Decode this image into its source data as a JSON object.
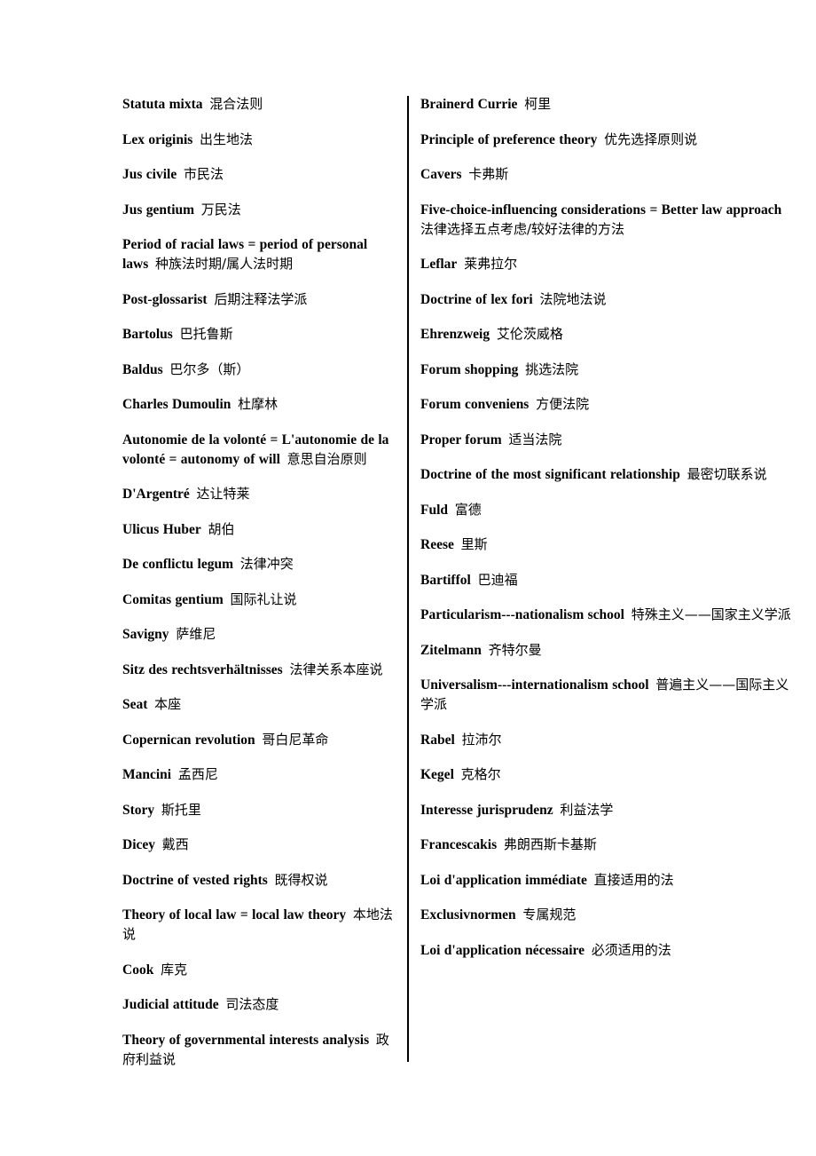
{
  "document": {
    "type": "bilingual-glossary",
    "subject": "Private International Law / Conflict of Laws terminology",
    "columns": [
      {
        "name": "left-column",
        "entries": [
          {
            "term": "Statuta mixta",
            "translation": "混合法则"
          },
          {
            "term": "Lex originis",
            "translation": "出生地法"
          },
          {
            "term": "Jus civile",
            "translation": "市民法"
          },
          {
            "term": "Jus gentium",
            "translation": "万民法"
          },
          {
            "term": "Period of racial laws = period of personal laws",
            "translation": "种族法时期/属人法时期"
          },
          {
            "term": "Post-glossarist",
            "translation": "后期注释法学派"
          },
          {
            "term": "Bartolus",
            "translation": "巴托鲁斯"
          },
          {
            "term": "Baldus",
            "translation": "巴尔多（斯）"
          },
          {
            "term": "Charles Dumoulin",
            "translation": "杜摩林"
          },
          {
            "term": "Autonomie de la volonté = L'autonomie de la volonté = autonomy of will",
            "translation": "意思自治原则"
          },
          {
            "term": "D'Argentré",
            "translation": "达让特莱"
          },
          {
            "term": "Ulicus Huber",
            "translation": "胡伯"
          },
          {
            "term": "De conflictu legum",
            "translation": "法律冲突"
          },
          {
            "term": "Comitas gentium",
            "translation": "国际礼让说"
          },
          {
            "term": "Savigny",
            "translation": "萨维尼"
          },
          {
            "term": "Sitz des rechtsverhältnisses",
            "translation": "法律关系本座说"
          },
          {
            "term": "Seat",
            "translation": "本座"
          },
          {
            "term": "Copernican revolution",
            "translation": "哥白尼革命"
          },
          {
            "term": "Mancini",
            "translation": "孟西尼"
          },
          {
            "term": "Story",
            "translation": "斯托里"
          },
          {
            "term": "Dicey",
            "translation": "戴西"
          },
          {
            "term": "Doctrine of vested rights",
            "translation": "既得权说"
          },
          {
            "term": "Theory of local law = local law theory",
            "translation": "本地法说"
          },
          {
            "term": "Cook",
            "translation": "库克"
          },
          {
            "term": "Judicial attitude",
            "translation": "司法态度"
          },
          {
            "term": "Theory of governmental interests analysis",
            "translation": "政府利益说"
          }
        ]
      },
      {
        "name": "right-column",
        "entries": [
          {
            "term": "Brainerd Currie",
            "translation": "柯里"
          },
          {
            "term": "Principle of preference theory",
            "translation": "优先选择原则说"
          },
          {
            "term": "Cavers",
            "translation": "卡弗斯"
          },
          {
            "term": "Five-choice-influencing considerations = Better law approach",
            "translation": "法律选择五点考虑/较好法律的方法"
          },
          {
            "term": "Leflar",
            "translation": "莱弗拉尔"
          },
          {
            "term": "Doctrine of lex fori",
            "translation": "法院地法说"
          },
          {
            "term": "Ehrenzweig",
            "translation": "艾伦茨威格"
          },
          {
            "term": "Forum shopping",
            "translation": "挑选法院"
          },
          {
            "term": "Forum conveniens",
            "translation": "方便法院"
          },
          {
            "term": "Proper forum",
            "translation": "适当法院"
          },
          {
            "term": "Doctrine of the most significant relationship",
            "translation": "最密切联系说"
          },
          {
            "term": "Fuld",
            "translation": "富德"
          },
          {
            "term": "Reese",
            "translation": "里斯"
          },
          {
            "term": "Bartiffol",
            "translation": "巴迪福"
          },
          {
            "term": "Particularism---nationalism school",
            "translation": "特殊主义——国家主义学派"
          },
          {
            "term": "Zitelmann",
            "translation": "齐特尔曼"
          },
          {
            "term": "Universalism---internationalism school",
            "translation": "普遍主义——国际主义学派"
          },
          {
            "term": "Rabel",
            "translation": "拉沛尔"
          },
          {
            "term": "Kegel",
            "translation": "克格尔"
          },
          {
            "term": "Interesse    jurisprudenz",
            "translation": "利益法学"
          },
          {
            "term": "Francescakis",
            "translation": "弗朗西斯卡基斯"
          },
          {
            "term": "Loi d'application immédiate",
            "translation": "直接适用的法"
          },
          {
            "term": "Exclusivnormen",
            "translation": "专属规范"
          },
          {
            "term": "Loi d'application nécessaire",
            "translation": "必须适用的法"
          }
        ]
      }
    ]
  }
}
